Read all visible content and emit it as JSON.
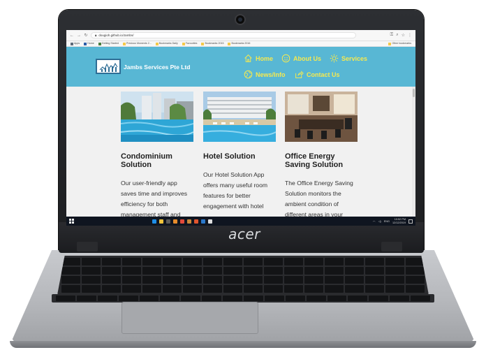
{
  "device": {
    "brand": "acer"
  },
  "browser": {
    "url": "dougioh.github.io/Jambs/",
    "bookmarks": [
      "Apps",
      "Home",
      "Getting Started",
      "Previous Moments 2...",
      "Bookmarks Daily",
      "Favourites",
      "Bookmarks 2015",
      "Bookmarks 2016"
    ],
    "other_bookmarks": "Other bookmarks"
  },
  "site": {
    "name": "Jambs Services Pte Ltd",
    "nav": [
      {
        "label": "Home",
        "icon": "home-icon"
      },
      {
        "label": "About Us",
        "icon": "smiley-icon"
      },
      {
        "label": "Services",
        "icon": "gear-icon"
      },
      {
        "label": "News/Info",
        "icon": "globe-icon"
      },
      {
        "label": "Contact Us",
        "icon": "share-icon"
      }
    ],
    "colors": {
      "header": "#58b7d4",
      "nav_text": "#f6e94f"
    },
    "cards": [
      {
        "title": "Condominium Solution",
        "text": "Our user-friendly app saves time and improves efficiency for both management staff and",
        "image": "condo-pool-image"
      },
      {
        "title": "Hotel Solution",
        "text": "Our Hotel Solution App offers many useful room features for better engagement with hotel guests. Ensuring that",
        "image": "hotel-pool-image"
      },
      {
        "title": "Office Energy Saving Solution",
        "text": "The Office Energy Saving Solution monitors the ambient condition of different areas in your",
        "image": "office-room-image"
      }
    ]
  },
  "taskbar": {
    "lang": "ENG",
    "time": "10:52 PM",
    "date": "12/12/2019"
  }
}
